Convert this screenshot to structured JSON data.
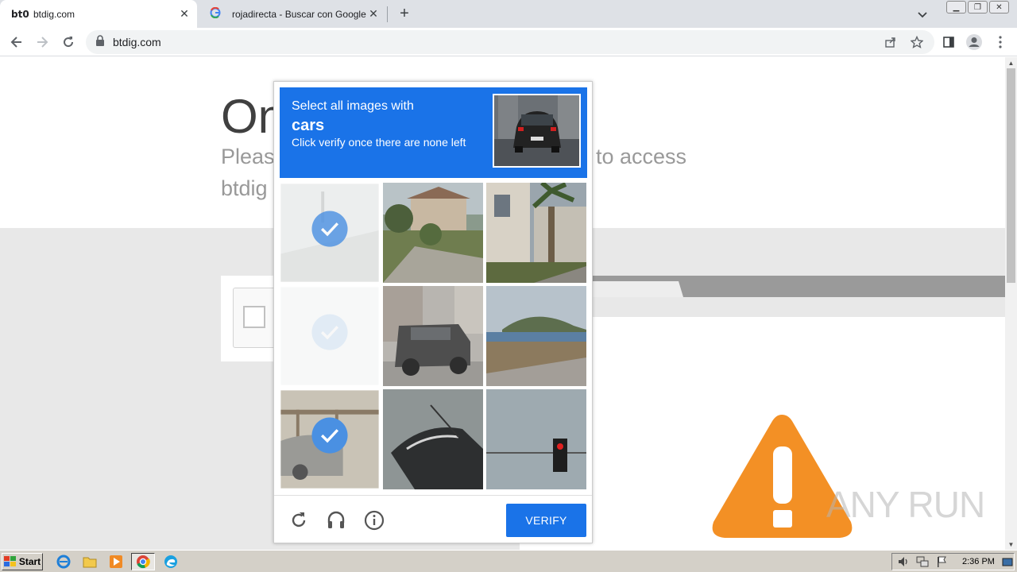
{
  "browser": {
    "tabs": [
      {
        "favicon": "bt0",
        "title": "btdig.com",
        "active": true
      },
      {
        "favicon": "google-g-icon",
        "title": "rojadirecta - Buscar con Google",
        "active": false
      }
    ],
    "url": "btdig.com"
  },
  "page": {
    "heading": "On",
    "subline1_left": "Pleas",
    "subline1_right": "to access",
    "subline2_left": "btdig"
  },
  "captcha": {
    "line1": "Select all images with",
    "target": "cars",
    "line3": "Click verify once there are none left",
    "tiles": [
      {
        "scene": "street-faded",
        "selected": true
      },
      {
        "scene": "house-palm",
        "selected": false
      },
      {
        "scene": "building-palm",
        "selected": false
      },
      {
        "scene": "blank-faded",
        "selected": true
      },
      {
        "scene": "jeep",
        "selected": false
      },
      {
        "scene": "coast",
        "selected": false
      },
      {
        "scene": "car-bridge",
        "selected": true
      },
      {
        "scene": "car-closeup",
        "selected": false
      },
      {
        "scene": "traffic-light",
        "selected": false
      }
    ],
    "verify_label": "VERIFY",
    "colors": {
      "accent": "#1a73e8",
      "check": "#4a90e2"
    }
  },
  "watermark": "ANY RUN",
  "taskbar": {
    "start_label": "Start",
    "clock": "2:36 PM"
  }
}
